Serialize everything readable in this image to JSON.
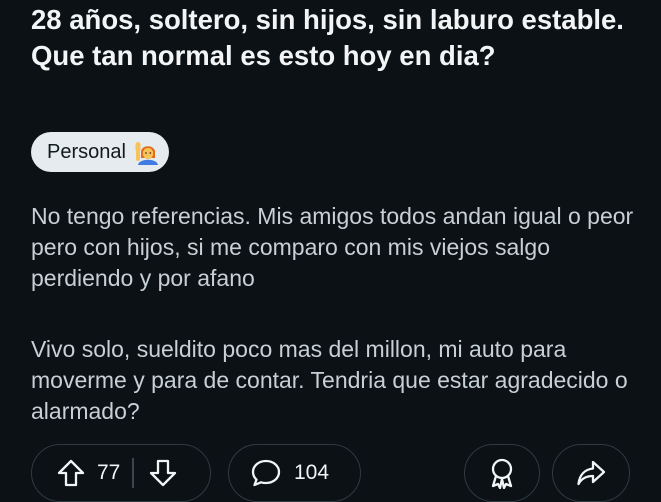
{
  "post": {
    "title": "28 años, soltero, sin hijos, sin laburo estable. Que tan normal es esto hoy en dia?",
    "flair": {
      "label": "Personal",
      "emoji_icon": "person-raising-hand-emoji"
    },
    "body": [
      "No tengo referencias. Mis amigos todos andan igual o peor pero con hijos, si me comparo con mis viejos salgo perdiendo y por afano",
      "Vivo solo, sueldito poco mas del millon, mi auto para moverme y para de contar. Tendria que estar agradecido o alarmado?"
    ]
  },
  "actions": {
    "upvote_icon": "upvote-arrow-icon",
    "vote_count": "77",
    "downvote_icon": "downvote-arrow-icon",
    "comment_icon": "speech-bubble-icon",
    "comment_count": "104",
    "award_icon": "award-ribbon-icon",
    "share_icon": "share-arrow-icon"
  },
  "colors": {
    "background": "#0b1115",
    "title_text": "#f2f4f5",
    "body_text": "#c7d0d4",
    "flair_background": "#e5ebee",
    "pill_border": "#2f3a40"
  }
}
